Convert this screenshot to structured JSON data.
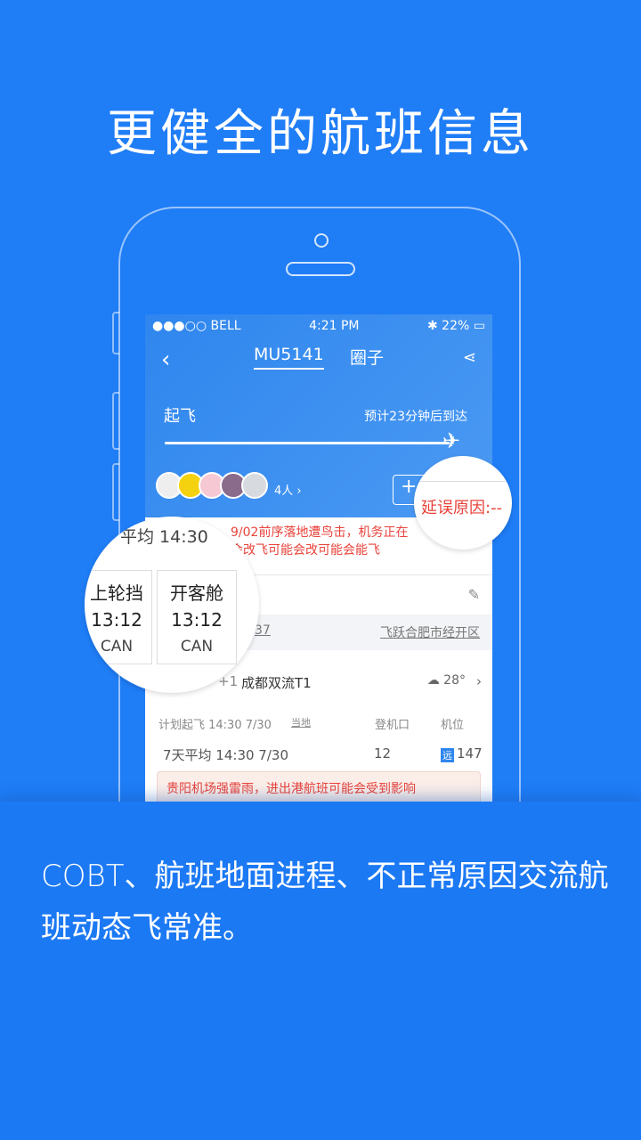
{
  "headline": "更健全的航班信息",
  "status": {
    "carrier": "●●●○○ BELL",
    "time": "4:21 PM",
    "battery": "22%"
  },
  "nav": {
    "tabs": [
      {
        "label": "MU5141",
        "active": true
      },
      {
        "label": "圈子",
        "active": false
      }
    ]
  },
  "flight": {
    "stage": "起飞",
    "eta": "预计23分钟后到达",
    "progress": 1.0,
    "member_count": "4人 ›"
  },
  "delay": {
    "partial_label": "平均 14:30",
    "line1": "9/02前序落地遭鸟击，机务正在",
    "line2": "会改飞可能会改可能会能飞"
  },
  "lens_right": {
    "label": "延误原因:--"
  },
  "lens_left": {
    "cells": [
      {
        "title": "上轮挡",
        "time": "13:12",
        "code": "CAN"
      },
      {
        "title": "开客舱",
        "time": "13:12",
        "code": "CAN"
      }
    ]
  },
  "address": {
    "partial": "点",
    "left": "37",
    "right": "飞跃合肥市经开区"
  },
  "arrival": {
    "offset": "+1",
    "airport": "成都双流T1",
    "temp": "28°"
  },
  "plan": {
    "label": "计划起飞 14:30 7/30",
    "local": "当地",
    "gate_header": "登机口",
    "stand_header": "机位"
  },
  "avg": {
    "label": "7天平均 14:30 7/30",
    "gate": "12",
    "stand_badge": "远",
    "stand": "147"
  },
  "warning": "贵阳机场强雷雨，进出港航班可能会受到影响",
  "bottom_text": "COBT、航班地面进程、不正常原因交流航班动态飞常准。",
  "colors": {
    "background": "#1f7df6",
    "alert": "#e8423a"
  }
}
